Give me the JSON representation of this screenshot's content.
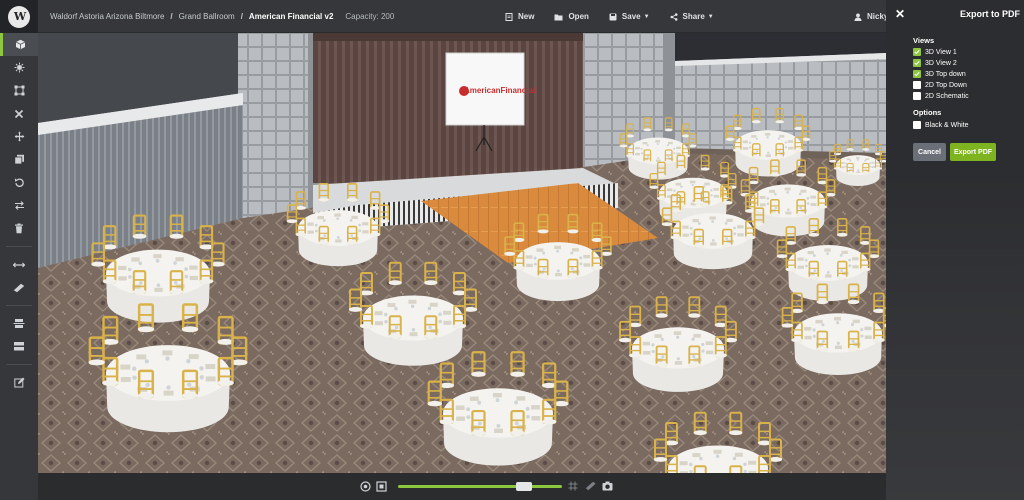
{
  "breadcrumb": {
    "venue": "Waldorf Astoria Arizona Biltmore",
    "room": "Grand Ballroom",
    "design": "American Financial v2",
    "separator": "/",
    "capacity": "Capacity: 200"
  },
  "toolbar": {
    "new_label": "New",
    "open_label": "Open",
    "save_label": "Save",
    "share_label": "Share"
  },
  "user": {
    "name": "Nicky"
  },
  "left_tools": [
    {
      "icon": "cube-icon",
      "active": true
    },
    {
      "icon": "burst-icon"
    },
    {
      "icon": "transform-icon"
    },
    {
      "icon": "close-icon"
    },
    {
      "icon": "move-icon"
    },
    {
      "icon": "layers-icon"
    },
    {
      "icon": "undo-icon"
    },
    {
      "icon": "swap-icon"
    },
    {
      "icon": "trash-icon"
    },
    {
      "icon": "measure-icon"
    },
    {
      "icon": "ruler-icon"
    },
    {
      "icon": "align-icon"
    },
    {
      "icon": "stack-icon"
    },
    {
      "icon": "edit-icon"
    }
  ],
  "scene": {
    "screen_logo": "AmericanFinancial",
    "colors": {
      "carpet": "#7a6a5f",
      "dance_floor": "#d98a3c",
      "tablecloth": "#f4f3f0",
      "chair": "#d9b24a",
      "stage_curtain": "#5a4541"
    }
  },
  "export_panel": {
    "title": "Export to PDF",
    "views_label": "Views",
    "views": [
      {
        "label": "3D View 1",
        "checked": true
      },
      {
        "label": "3D View 2",
        "checked": true
      },
      {
        "label": "3D Top down",
        "checked": true
      },
      {
        "label": "2D Top Down",
        "checked": false
      },
      {
        "label": "2D Schematic",
        "checked": false
      }
    ],
    "options_label": "Options",
    "options": [
      {
        "label": "Black & White",
        "checked": false
      }
    ],
    "cancel_label": "Cancel",
    "export_label": "Export PDF"
  },
  "zoom": {
    "level": 0.77
  },
  "accent_color": "#8dc63f"
}
